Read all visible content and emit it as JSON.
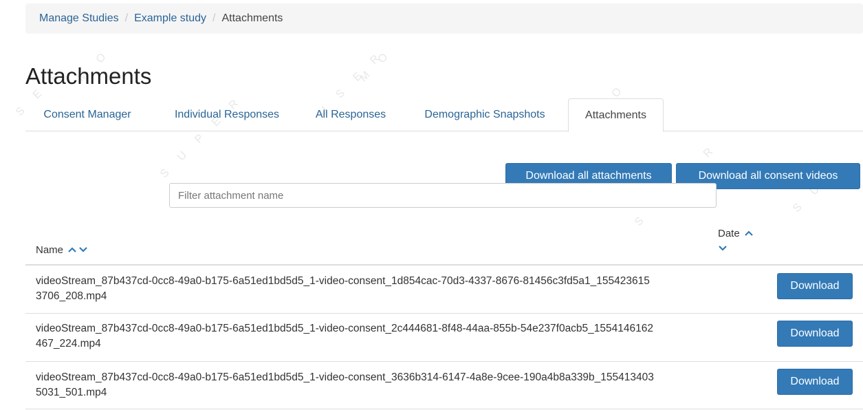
{
  "breadcrumb": {
    "items": [
      "Manage Studies",
      "Example study"
    ],
    "separator": "/",
    "current": "Attachments"
  },
  "page": {
    "title": "Attachments"
  },
  "tabs": [
    {
      "label": "Consent Manager",
      "active": false
    },
    {
      "label": "Individual Responses",
      "active": false
    },
    {
      "label": "All Responses",
      "active": false
    },
    {
      "label": "Demographic Snapshots",
      "active": false
    },
    {
      "label": "Attachments",
      "active": true
    }
  ],
  "actions": {
    "download_all_attachments": "Download all attachments",
    "download_all_consent_videos": "Download all consent videos"
  },
  "filter": {
    "placeholder": "Filter attachment name",
    "value": ""
  },
  "table": {
    "columns": {
      "name": "Name",
      "date": "Date"
    },
    "rows": [
      {
        "name": "videoStream_87b437cd-0cc8-49a0-b175-6a51ed1bd5d5_1-video-consent_1d854cac-70d3-4337-8676-81456c3fd5a1_1554236153706_208.mp4",
        "action": "Download"
      },
      {
        "name": "videoStream_87b437cd-0cc8-49a0-b175-6a51ed1bd5d5_1-video-consent_2c444681-8f48-44aa-855b-54e237f0acb5_1554146162467_224.mp4",
        "action": "Download"
      },
      {
        "name": "videoStream_87b437cd-0cc8-49a0-b175-6a51ed1bd5d5_1-video-consent_3636b314-6147-4a8e-9cee-190a4b8a339b_1554134035031_501.mp4",
        "action": "Download"
      }
    ]
  },
  "icons": {
    "sort_up": "chevron-up-icon",
    "sort_down": "chevron-down-icon"
  },
  "colors": {
    "link": "#2a6496",
    "primary_button": "#337ab7",
    "breadcrumb_bg": "#f5f5f5",
    "border": "#dddddd"
  }
}
